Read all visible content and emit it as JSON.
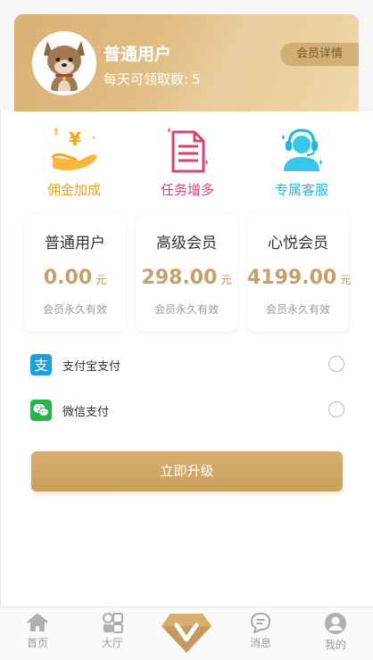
{
  "header": {
    "user_name": "普通用户",
    "quota_label": "每天可领取数:",
    "quota_value": "5",
    "detail_button": "会员详情"
  },
  "features": [
    {
      "label": "佣金加成",
      "icon": "hand-coin-icon",
      "color": "#e3a229"
    },
    {
      "label": "任务增多",
      "icon": "document-list-icon",
      "color": "#d4466e"
    },
    {
      "label": "专属客服",
      "icon": "customer-service-icon",
      "color": "#1eb8e0"
    }
  ],
  "plans": [
    {
      "name": "普通用户",
      "price": "0.00",
      "unit": "元",
      "validity": "会员永久有效"
    },
    {
      "name": "高级会员",
      "price": "298.00",
      "unit": "元",
      "validity": "会员永久有效"
    },
    {
      "name": "心悦会员",
      "price": "4199.00",
      "unit": "元",
      "validity": "会员永久有效"
    }
  ],
  "payment": [
    {
      "label": "支付宝支付",
      "icon": "alipay-icon",
      "icon_glyph": "支",
      "color": "#1a9fe0"
    },
    {
      "label": "微信支付",
      "icon": "wechat-icon",
      "color": "#2bb24c"
    }
  ],
  "upgrade_button": "立即升级",
  "tabbar": [
    {
      "label": "首页",
      "icon": "home-icon"
    },
    {
      "label": "大厅",
      "icon": "hall-grid-icon"
    },
    {
      "label": "",
      "icon": "vip-diamond-icon"
    },
    {
      "label": "消息",
      "icon": "message-icon"
    },
    {
      "label": "我的",
      "icon": "profile-icon"
    }
  ],
  "colors": {
    "gold": "#c9a060",
    "price": "#c6a06a",
    "gray_text": "#999999"
  }
}
